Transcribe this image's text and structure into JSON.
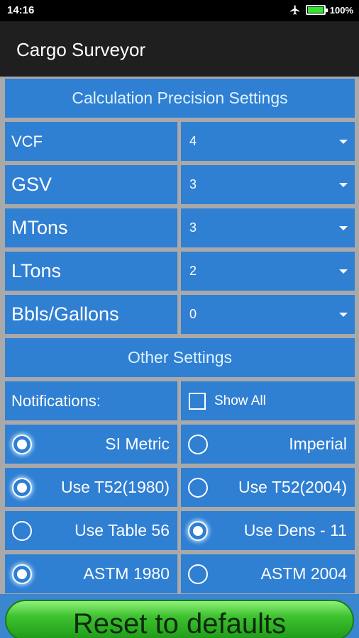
{
  "status_bar": {
    "time": "14:16",
    "airplane_icon": "airplane-icon",
    "battery": "100%"
  },
  "app_bar": {
    "title": "Cargo Surveyor"
  },
  "sections": {
    "precision_header": "Calculation Precision Settings",
    "other_header": "Other Settings"
  },
  "precision": [
    {
      "label": "VCF",
      "value": "4"
    },
    {
      "label": "GSV",
      "value": "3"
    },
    {
      "label": "MTons",
      "value": "3"
    },
    {
      "label": "LTons",
      "value": "2"
    },
    {
      "label": "Bbls/Gallons",
      "value": "0"
    }
  ],
  "notifications": {
    "label": "Notifications:",
    "checkbox_label": "Show All",
    "checked": false
  },
  "radio_rows": [
    {
      "left": {
        "label": "SI Metric",
        "selected": true
      },
      "right": {
        "label": "Imperial",
        "selected": false
      }
    },
    {
      "left": {
        "label": "Use T52(1980)",
        "selected": true
      },
      "right": {
        "label": "Use T52(2004)",
        "selected": false
      }
    },
    {
      "left": {
        "label": "Use Table 56",
        "selected": false
      },
      "right": {
        "label": "Use Dens - 11",
        "selected": true
      }
    },
    {
      "left": {
        "label": "ASTM 1980",
        "selected": true
      },
      "right": {
        "label": "ASTM 2004",
        "selected": false
      }
    }
  ],
  "reset_button": {
    "label": "Reset to defaults"
  },
  "colors": {
    "cell_blue": "#2f7fd3",
    "grid_gray": "#a9a9a9",
    "app_bar": "#1f1f1f",
    "button_green": "#3ec22f"
  }
}
